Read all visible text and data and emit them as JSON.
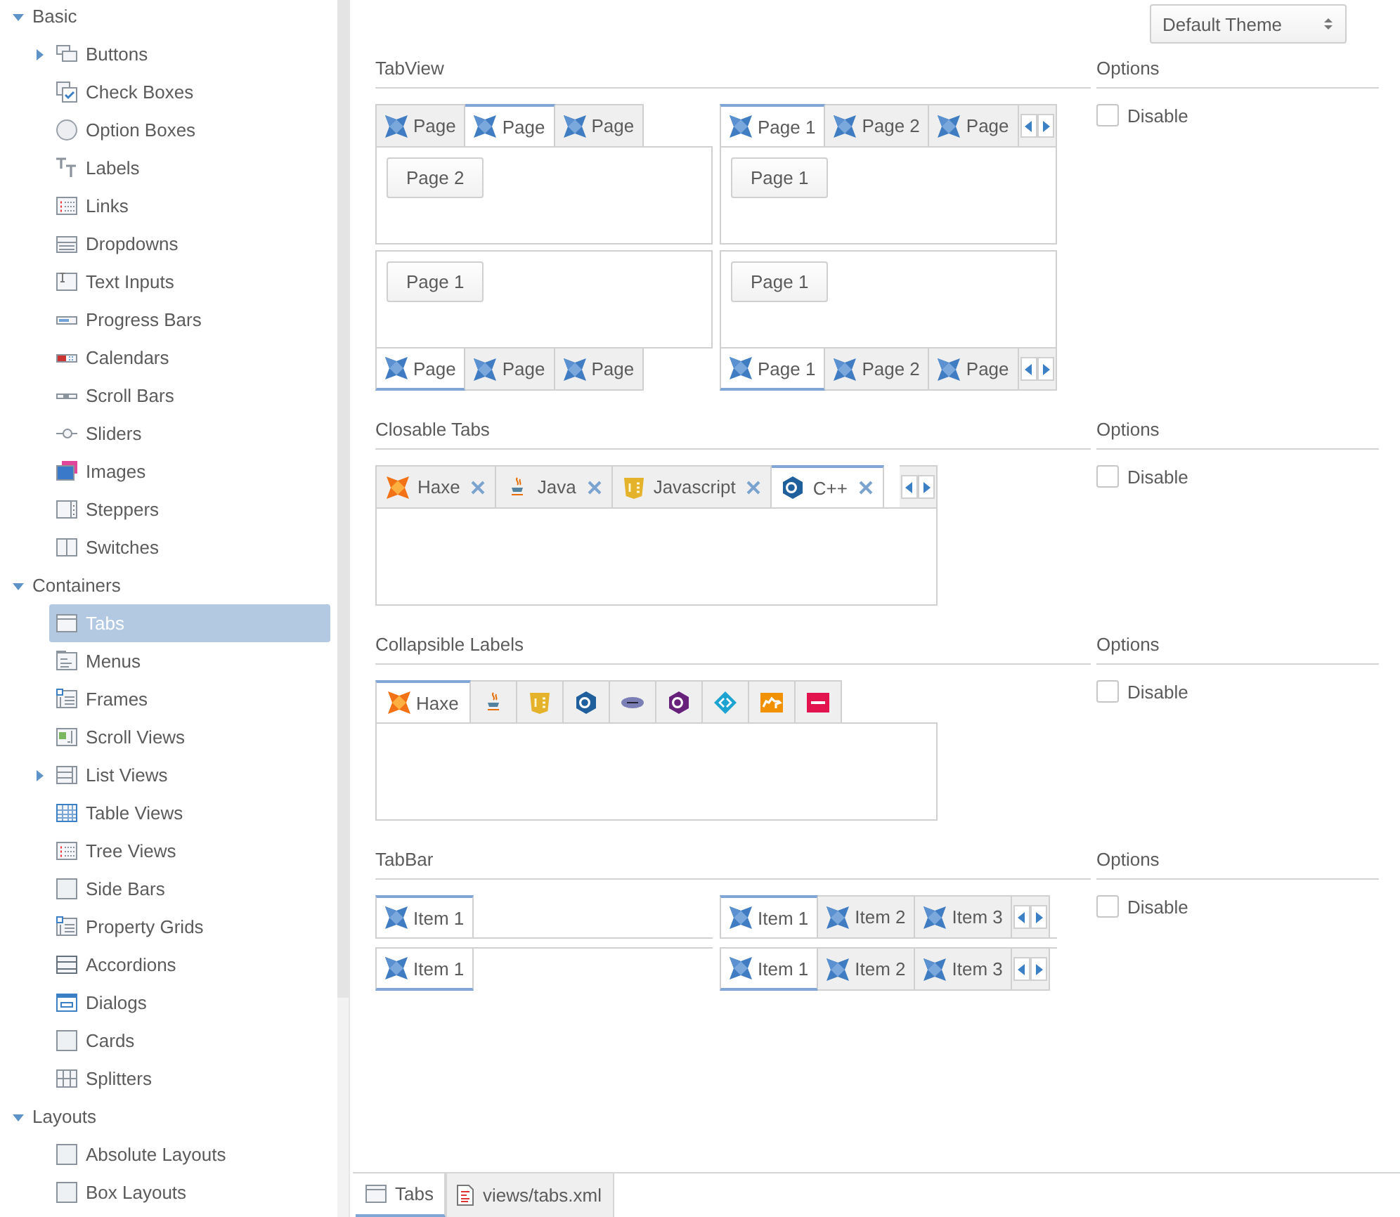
{
  "sidebar": {
    "groups": [
      {
        "label": "Basic",
        "expanded": true,
        "children": [
          {
            "label": "Buttons",
            "kind": "branch",
            "selected": false
          },
          {
            "label": "Check Boxes",
            "kind": "leaf",
            "selected": false
          },
          {
            "label": "Option Boxes",
            "kind": "leaf",
            "selected": false
          },
          {
            "label": "Labels",
            "kind": "leaf",
            "selected": false
          },
          {
            "label": "Links",
            "kind": "leaf",
            "selected": false
          },
          {
            "label": "Dropdowns",
            "kind": "leaf",
            "selected": false
          },
          {
            "label": "Text Inputs",
            "kind": "leaf",
            "selected": false
          },
          {
            "label": "Progress Bars",
            "kind": "leaf",
            "selected": false
          },
          {
            "label": "Calendars",
            "kind": "leaf",
            "selected": false
          },
          {
            "label": "Scroll Bars",
            "kind": "leaf",
            "selected": false
          },
          {
            "label": "Sliders",
            "kind": "leaf",
            "selected": false
          },
          {
            "label": "Images",
            "kind": "leaf",
            "selected": false
          },
          {
            "label": "Steppers",
            "kind": "leaf",
            "selected": false
          },
          {
            "label": "Switches",
            "kind": "leaf",
            "selected": false
          }
        ]
      },
      {
        "label": "Containers",
        "expanded": true,
        "children": [
          {
            "label": "Tabs",
            "kind": "leaf",
            "selected": true
          },
          {
            "label": "Menus",
            "kind": "leaf",
            "selected": false
          },
          {
            "label": "Frames",
            "kind": "leaf",
            "selected": false
          },
          {
            "label": "Scroll Views",
            "kind": "leaf",
            "selected": false
          },
          {
            "label": "List Views",
            "kind": "branch",
            "selected": false
          },
          {
            "label": "Table Views",
            "kind": "leaf",
            "selected": false
          },
          {
            "label": "Tree Views",
            "kind": "leaf",
            "selected": false
          },
          {
            "label": "Side Bars",
            "kind": "leaf",
            "selected": false
          },
          {
            "label": "Property Grids",
            "kind": "leaf",
            "selected": false
          },
          {
            "label": "Accordions",
            "kind": "leaf",
            "selected": false
          },
          {
            "label": "Dialogs",
            "kind": "leaf",
            "selected": false
          },
          {
            "label": "Cards",
            "kind": "leaf",
            "selected": false
          },
          {
            "label": "Splitters",
            "kind": "leaf",
            "selected": false
          }
        ]
      },
      {
        "label": "Layouts",
        "expanded": true,
        "children": [
          {
            "label": "Absolute Layouts",
            "kind": "leaf",
            "selected": false
          },
          {
            "label": "Box Layouts",
            "kind": "leaf",
            "selected": false
          }
        ]
      }
    ]
  },
  "theme_dropdown": {
    "value": "Default Theme"
  },
  "sections": [
    {
      "title": "TabView",
      "kind": "tabview",
      "views": [
        {
          "kind": "top-tabs",
          "scrollable": false,
          "button": "Page 2",
          "tabs": [
            {
              "label": "Page",
              "selected": false
            },
            {
              "label": "Page",
              "selected": true
            },
            {
              "label": "Page",
              "selected": false
            }
          ]
        },
        {
          "kind": "top-tabs",
          "scrollable": true,
          "button": "Page 1",
          "tabs": [
            {
              "label": "Page 1",
              "selected": true
            },
            {
              "label": "Page 2",
              "selected": false
            },
            {
              "label": "Page",
              "selected": false
            }
          ]
        },
        {
          "kind": "bottom-tabs",
          "scrollable": false,
          "button": "Page 1",
          "tabs": [
            {
              "label": "Page",
              "selected": true
            },
            {
              "label": "Page",
              "selected": false
            },
            {
              "label": "Page",
              "selected": false
            }
          ]
        },
        {
          "kind": "bottom-tabs",
          "scrollable": true,
          "button": "Page 1",
          "tabs": [
            {
              "label": "Page 1",
              "selected": true
            },
            {
              "label": "Page 2",
              "selected": false
            },
            {
              "label": "Page",
              "selected": false
            }
          ]
        }
      ],
      "options": {
        "title": "Options",
        "checkboxes": [
          {
            "label": "Disable",
            "checked": false
          }
        ]
      }
    },
    {
      "title": "Closable Tabs",
      "kind": "closable",
      "views": [
        {
          "kind": "top-tabs",
          "scrollable": true,
          "tabs": [
            {
              "label": "Haxe",
              "selected": false
            },
            {
              "label": "Java",
              "selected": false
            },
            {
              "label": "Javascript",
              "selected": false
            },
            {
              "label": "C++",
              "selected": true
            }
          ]
        }
      ],
      "options": {
        "title": "Options",
        "checkboxes": [
          {
            "label": "Disable",
            "checked": false
          }
        ]
      }
    },
    {
      "title": "Collapsible Labels",
      "kind": "collapsible",
      "views": [
        {
          "kind": "top-tabs",
          "scrollable": false,
          "tabs": [
            {
              "label": "Haxe",
              "selected": true
            },
            {
              "selected": false
            },
            {
              "selected": false
            },
            {
              "selected": false
            },
            {
              "selected": false
            },
            {
              "selected": false
            },
            {
              "selected": false
            },
            {
              "selected": false
            },
            {
              "selected": false
            }
          ]
        }
      ],
      "options": {
        "title": "Options",
        "checkboxes": [
          {
            "label": "Disable",
            "checked": false
          }
        ]
      }
    },
    {
      "title": "TabBar",
      "kind": "tabbar",
      "views": [
        {
          "kind": "top-tabs",
          "scrollable": false,
          "tabs": [
            {
              "label": "Item 1",
              "selected": true
            }
          ]
        },
        {
          "kind": "top-tabs",
          "scrollable": true,
          "tabs": [
            {
              "label": "Item 1",
              "selected": true
            },
            {
              "label": "Item 2",
              "selected": false
            },
            {
              "label": "Item 3",
              "selected": false
            }
          ]
        },
        {
          "kind": "bottom-tabs",
          "scrollable": false,
          "tabs": [
            {
              "label": "Item 1",
              "selected": true
            }
          ]
        },
        {
          "kind": "bottom-tabs",
          "scrollable": true,
          "tabs": [
            {
              "label": "Item 1",
              "selected": true
            },
            {
              "label": "Item 2",
              "selected": false
            },
            {
              "label": "Item 3",
              "selected": false
            }
          ]
        }
      ],
      "options": {
        "title": "Options",
        "checkboxes": [
          {
            "label": "Disable",
            "checked": false
          }
        ]
      }
    }
  ],
  "bottom_tabs": [
    {
      "label": "Tabs",
      "selected": true
    },
    {
      "label": "views/tabs.xml",
      "selected": false
    }
  ]
}
